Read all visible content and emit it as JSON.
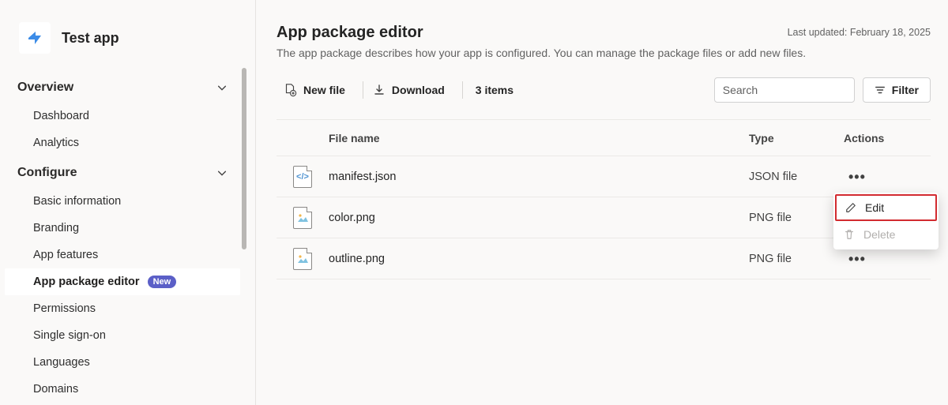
{
  "header": {
    "app_name": "Test app"
  },
  "sidebar": {
    "overview": {
      "label": "Overview",
      "items": [
        {
          "label": "Dashboard"
        },
        {
          "label": "Analytics"
        }
      ]
    },
    "configure": {
      "label": "Configure",
      "items": [
        {
          "label": "Basic information"
        },
        {
          "label": "Branding"
        },
        {
          "label": "App features"
        },
        {
          "label": "App package editor",
          "active": true,
          "badge": "New"
        },
        {
          "label": "Permissions"
        },
        {
          "label": "Single sign-on"
        },
        {
          "label": "Languages"
        },
        {
          "label": "Domains"
        }
      ]
    }
  },
  "main": {
    "title": "App package editor",
    "description": "The app package describes how your app is configured. You can manage the package files or add new files.",
    "last_updated": "Last updated: February 18, 2025",
    "toolbar": {
      "new_file": "New file",
      "download": "Download",
      "item_count": "3 items",
      "search_placeholder": "Search",
      "filter": "Filter"
    },
    "columns": {
      "name": "File name",
      "type": "Type",
      "actions": "Actions"
    },
    "rows": [
      {
        "name": "manifest.json",
        "type": "JSON file",
        "kind": "code"
      },
      {
        "name": "color.png",
        "type": "PNG file",
        "kind": "img"
      },
      {
        "name": "outline.png",
        "type": "PNG file",
        "kind": "img"
      }
    ]
  },
  "context_menu": {
    "edit": "Edit",
    "delete": "Delete"
  }
}
